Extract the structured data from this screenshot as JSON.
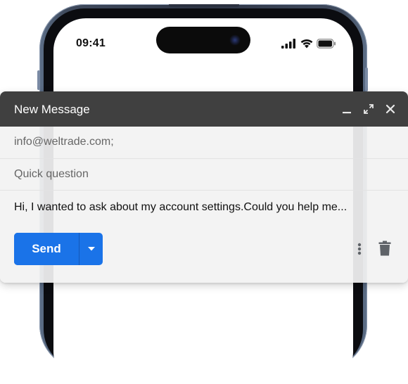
{
  "status_bar": {
    "time": "09:41",
    "icons": [
      "cellular-signal-icon",
      "wifi-icon",
      "battery-icon"
    ]
  },
  "compose": {
    "title": "New Message",
    "header_icons": [
      "minimize-icon",
      "expand-icon",
      "close-icon"
    ],
    "to": "info@weltrade.com;",
    "subject": "Quick question",
    "body": "Hi, I wanted to ask about my account settings.Could you help me...",
    "send_label": "Send",
    "send_options_icon": "caret-down-icon",
    "toolbar_icons": [
      "more-vert-icon",
      "trash-icon"
    ]
  },
  "colors": {
    "header_bg": "#404040",
    "send_bg": "#1a73e8",
    "phone_frame": "#3f4a5d"
  }
}
